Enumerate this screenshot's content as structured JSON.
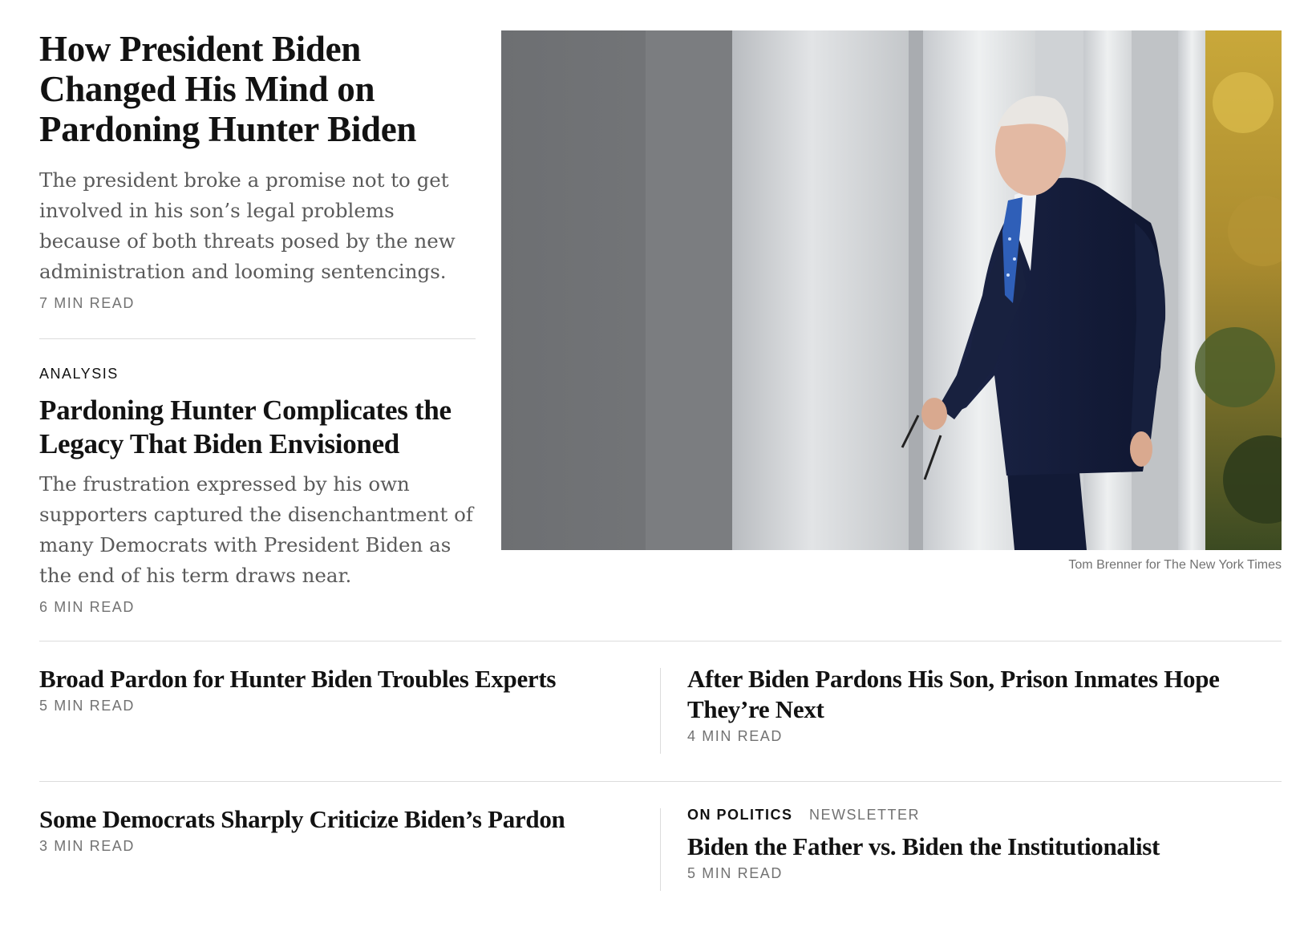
{
  "lead": {
    "headline": "How President Biden Changed His Mind on Pardoning Hunter Biden",
    "summary": "The president broke a promise not to get involved in his son’s legal problems because of both threats posed by the new administration and looming sentencings.",
    "read_time": "7 MIN READ"
  },
  "analysis": {
    "kicker": "ANALYSIS",
    "headline": "Pardoning Hunter Complicates the Legacy That Biden Envisioned",
    "summary": "The frustration expressed by his own supporters captured the disenchantment of many Democrats with President Biden as the end of his term draws near.",
    "read_time": "6 MIN READ"
  },
  "photo": {
    "credit": "Tom Brenner for The New York Times"
  },
  "stories": [
    {
      "headline": "Broad Pardon for Hunter Biden Troubles Experts",
      "read_time": "5 MIN READ"
    },
    {
      "headline": "After Biden Pardons His Son, Prison Inmates Hope They’re Next",
      "read_time": "4 MIN READ"
    },
    {
      "headline": "Some Democrats Sharply Criticize Biden’s Pardon",
      "read_time": "3 MIN READ"
    },
    {
      "kicker": "ON POLITICS",
      "kicker_secondary": "NEWSLETTER",
      "headline": "Biden the Father vs. Biden the Institutionalist",
      "read_time": "5 MIN READ"
    }
  ]
}
